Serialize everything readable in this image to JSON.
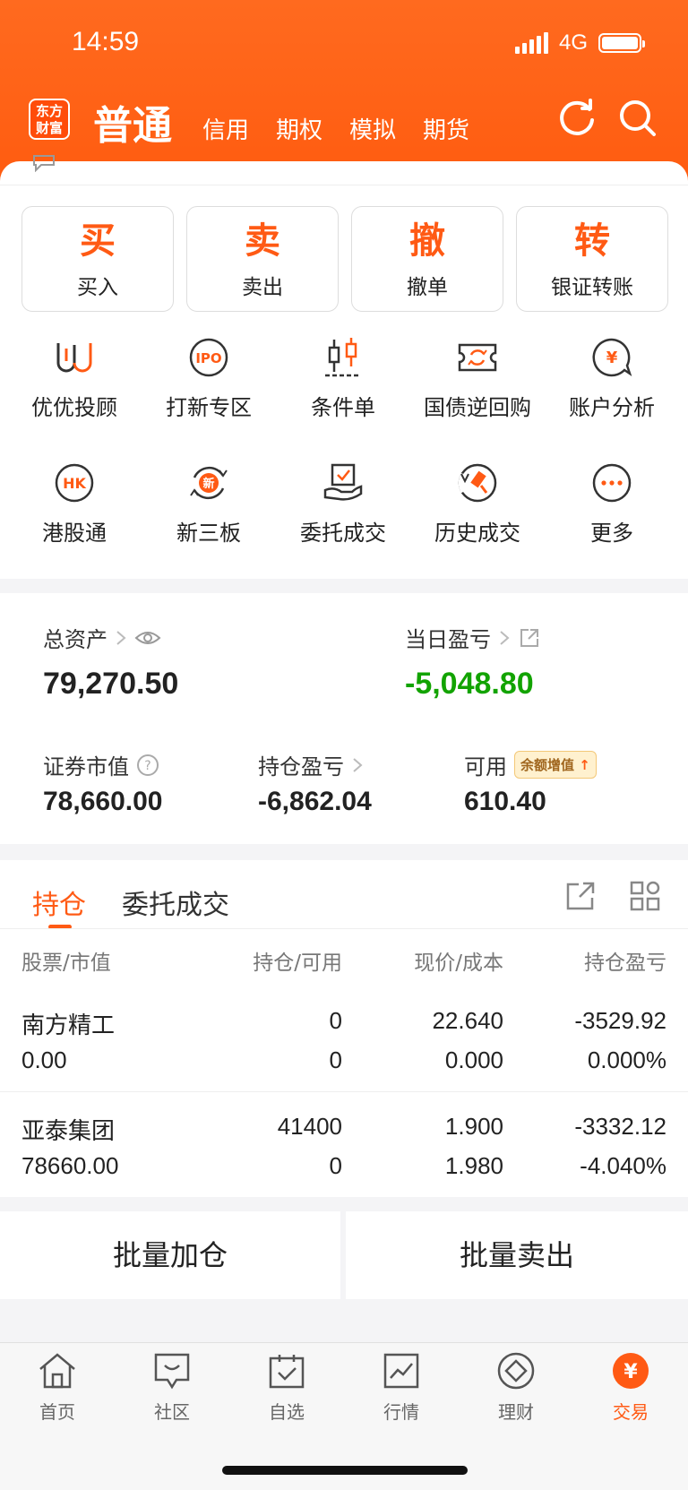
{
  "status_bar": {
    "time": "14:59",
    "network": "4G"
  },
  "header": {
    "logo_text": "东方\n财富",
    "tabs": [
      {
        "label": "普通",
        "active": true
      },
      {
        "label": "信用",
        "active": false
      },
      {
        "label": "期权",
        "active": false
      },
      {
        "label": "模拟",
        "active": false
      },
      {
        "label": "期货",
        "active": false
      }
    ],
    "icons": [
      "refresh-icon",
      "search-icon"
    ]
  },
  "trade_buttons": [
    {
      "big": "买",
      "small": "买入"
    },
    {
      "big": "卖",
      "small": "卖出"
    },
    {
      "big": "撤",
      "small": "撤单"
    },
    {
      "big": "转",
      "small": "银证转账"
    }
  ],
  "functions": [
    {
      "label": "优优投顾",
      "icon": "uu-advisor-icon"
    },
    {
      "label": "打新专区",
      "icon": "ipo-icon"
    },
    {
      "label": "条件单",
      "icon": "candlestick-icon"
    },
    {
      "label": "国债逆回购",
      "icon": "ticket-icon"
    },
    {
      "label": "账户分析",
      "icon": "yuan-chat-icon"
    },
    {
      "label": "港股通",
      "icon": "hk-icon"
    },
    {
      "label": "新三板",
      "icon": "new-board-icon"
    },
    {
      "label": "委托成交",
      "icon": "hand-check-icon"
    },
    {
      "label": "历史成交",
      "icon": "gavel-icon"
    },
    {
      "label": "更多",
      "icon": "more-icon"
    }
  ],
  "assets": {
    "total_label": "总资产",
    "total_value": "79,270.50",
    "daily_pl_label": "当日盈亏",
    "daily_pl_value": "-5,048.80",
    "market_value_label": "证券市值",
    "market_value": "78,660.00",
    "position_pl_label": "持仓盈亏",
    "position_pl_value": "-6,862.04",
    "available_label": "可用",
    "available_badge": "余额增值",
    "available_value": "610.40"
  },
  "holdings": {
    "tabs": [
      "持仓",
      "委托成交"
    ],
    "headers": [
      "股票/市值",
      "持仓/可用",
      "现价/成本",
      "持仓盈亏"
    ],
    "rows": [
      {
        "name": "南方精工",
        "market_value": "0.00",
        "position": "0",
        "available": "0",
        "price": "22.640",
        "cost": "0.000",
        "pl": "-3529.92",
        "pl_pct": "0.000%"
      },
      {
        "name": "亚泰集团",
        "market_value": "78660.00",
        "position": "41400",
        "available": "0",
        "price": "1.900",
        "cost": "1.980",
        "pl": "-3332.12",
        "pl_pct": "-4.040%"
      }
    ]
  },
  "actions": {
    "batch_add": "批量加仓",
    "batch_sell": "批量卖出"
  },
  "tabbar": [
    {
      "label": "首页",
      "icon": "home-icon",
      "active": false
    },
    {
      "label": "社区",
      "icon": "community-icon",
      "active": false
    },
    {
      "label": "自选",
      "icon": "watchlist-icon",
      "active": false
    },
    {
      "label": "行情",
      "icon": "market-icon",
      "active": false
    },
    {
      "label": "理财",
      "icon": "wealth-icon",
      "active": false
    },
    {
      "label": "交易",
      "icon": "trade-icon",
      "active": true
    }
  ],
  "colors": {
    "brand": "#ff5a14",
    "loss_green": "#12a300"
  }
}
